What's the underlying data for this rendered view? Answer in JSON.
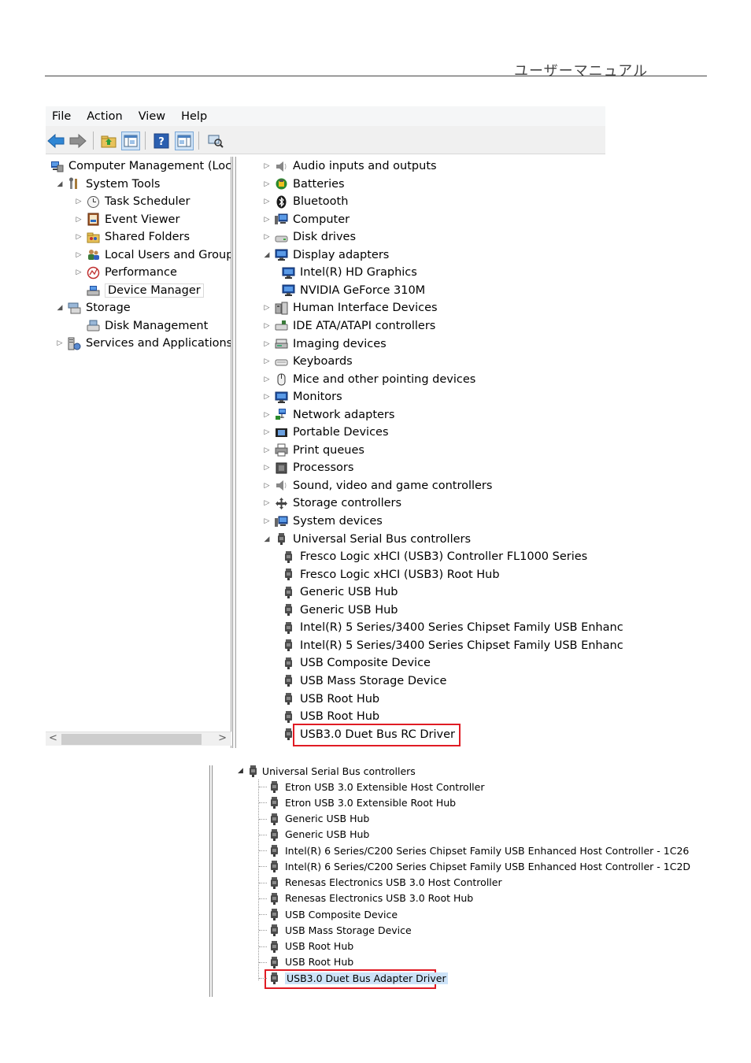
{
  "page_header": {
    "title": "ユーザーマニュアル"
  },
  "screenshot1": {
    "menu": [
      "File",
      "Action",
      "View",
      "Help"
    ],
    "left_tree": [
      {
        "label": "Computer Management (Local",
        "icon": "computer-management-icon",
        "twisty": ""
      },
      {
        "label": "System Tools",
        "icon": "system-tools-icon",
        "twisty": "◢"
      },
      {
        "label": "Task Scheduler",
        "icon": "clock-icon",
        "twisty": "▷"
      },
      {
        "label": "Event Viewer",
        "icon": "event-viewer-icon",
        "twisty": "▷"
      },
      {
        "label": "Shared Folders",
        "icon": "shared-folder-icon",
        "twisty": "▷"
      },
      {
        "label": "Local Users and Groups",
        "icon": "users-icon",
        "twisty": "▷"
      },
      {
        "label": "Performance",
        "icon": "performance-icon",
        "twisty": "▷"
      },
      {
        "label": "Device Manager",
        "icon": "device-manager-icon",
        "twisty": ""
      },
      {
        "label": "Storage",
        "icon": "storage-icon",
        "twisty": "◢"
      },
      {
        "label": "Disk Management",
        "icon": "disk-management-icon",
        "twisty": ""
      },
      {
        "label": "Services and Applications",
        "icon": "services-icon",
        "twisty": "▷"
      }
    ],
    "selected_item": "Device Manager",
    "device_tree": [
      {
        "label": "Audio inputs and outputs",
        "icon": "speaker-icon",
        "twisty": "▷"
      },
      {
        "label": "Batteries",
        "icon": "battery-icon",
        "twisty": "▷"
      },
      {
        "label": "Bluetooth",
        "icon": "bluetooth-icon",
        "twisty": "▷"
      },
      {
        "label": "Computer",
        "icon": "computer-icon",
        "twisty": "▷"
      },
      {
        "label": "Disk drives",
        "icon": "disk-drive-icon",
        "twisty": "▷"
      },
      {
        "label": "Display adapters",
        "icon": "monitor-icon",
        "twisty": "◢"
      },
      {
        "label": "Intel(R) HD Graphics",
        "icon": "monitor-icon",
        "twisty": "",
        "child": true
      },
      {
        "label": "NVIDIA GeForce 310M",
        "icon": "monitor-icon",
        "twisty": "",
        "child": true
      },
      {
        "label": "Human Interface Devices",
        "icon": "hid-icon",
        "twisty": "▷"
      },
      {
        "label": "IDE ATA/ATAPI controllers",
        "icon": "ide-icon",
        "twisty": "▷"
      },
      {
        "label": "Imaging devices",
        "icon": "scanner-icon",
        "twisty": "▷"
      },
      {
        "label": "Keyboards",
        "icon": "keyboard-icon",
        "twisty": "▷"
      },
      {
        "label": "Mice and other pointing devices",
        "icon": "mouse-icon",
        "twisty": "▷"
      },
      {
        "label": "Monitors",
        "icon": "monitor-icon",
        "twisty": "▷"
      },
      {
        "label": "Network adapters",
        "icon": "network-icon",
        "twisty": "▷"
      },
      {
        "label": "Portable Devices",
        "icon": "portable-device-icon",
        "twisty": "▷"
      },
      {
        "label": "Print queues",
        "icon": "printer-icon",
        "twisty": "▷"
      },
      {
        "label": "Processors",
        "icon": "processor-icon",
        "twisty": "▷"
      },
      {
        "label": "Sound, video and game controllers",
        "icon": "speaker-icon",
        "twisty": "▷"
      },
      {
        "label": "Storage controllers",
        "icon": "storage-controller-icon",
        "twisty": "▷"
      },
      {
        "label": "System devices",
        "icon": "computer-icon",
        "twisty": "▷"
      },
      {
        "label": "Universal Serial Bus controllers",
        "icon": "usb-icon",
        "twisty": "◢"
      },
      {
        "label": "Fresco Logic xHCI (USB3) Controller FL1000 Series",
        "icon": "usb-icon",
        "twisty": "",
        "child": true
      },
      {
        "label": "Fresco Logic xHCI (USB3) Root Hub",
        "icon": "usb-icon",
        "twisty": "",
        "child": true
      },
      {
        "label": "Generic USB Hub",
        "icon": "usb-icon",
        "twisty": "",
        "child": true
      },
      {
        "label": "Generic USB Hub",
        "icon": "usb-icon",
        "twisty": "",
        "child": true
      },
      {
        "label": "Intel(R) 5 Series/3400 Series Chipset Family USB Enhanc",
        "icon": "usb-icon",
        "twisty": "",
        "child": true
      },
      {
        "label": "Intel(R) 5 Series/3400 Series Chipset Family USB Enhanc",
        "icon": "usb-icon",
        "twisty": "",
        "child": true
      },
      {
        "label": "USB Composite Device",
        "icon": "usb-icon",
        "twisty": "",
        "child": true
      },
      {
        "label": "USB Mass Storage Device",
        "icon": "usb-icon",
        "twisty": "",
        "child": true
      },
      {
        "label": "USB Root Hub",
        "icon": "usb-icon",
        "twisty": "",
        "child": true
      },
      {
        "label": "USB Root Hub",
        "icon": "usb-icon",
        "twisty": "",
        "child": true
      },
      {
        "label": "USB3.0 Duet Bus RC Driver",
        "icon": "usb-icon",
        "twisty": "",
        "child": true,
        "highlight": true
      }
    ],
    "scroll_left": "<",
    "scroll_right": ">"
  },
  "screenshot2": {
    "parent": {
      "label": "Universal Serial Bus controllers",
      "twisty": "◢"
    },
    "children": [
      "Etron USB 3.0 Extensible Host Controller",
      "Etron USB 3.0 Extensible Root Hub",
      "Generic USB Hub",
      "Generic USB Hub",
      "Intel(R) 6 Series/C200 Series Chipset Family USB Enhanced Host Controller - 1C26",
      "Intel(R) 6 Series/C200 Series Chipset Family USB Enhanced Host Controller - 1C2D",
      "Renesas Electronics USB 3.0 Host Controller",
      "Renesas Electronics USB 3.0 Root Hub",
      "USB Composite Device",
      "USB Mass Storage Device",
      "USB Root Hub",
      "USB Root Hub",
      "USB3.0 Duet Bus Adapter Driver"
    ],
    "highlight_index": 12
  },
  "colors": {
    "highlight_box": "#e01c24",
    "selection_border": "#d9d9d9",
    "toolbar_active": "#cfe3f7"
  }
}
